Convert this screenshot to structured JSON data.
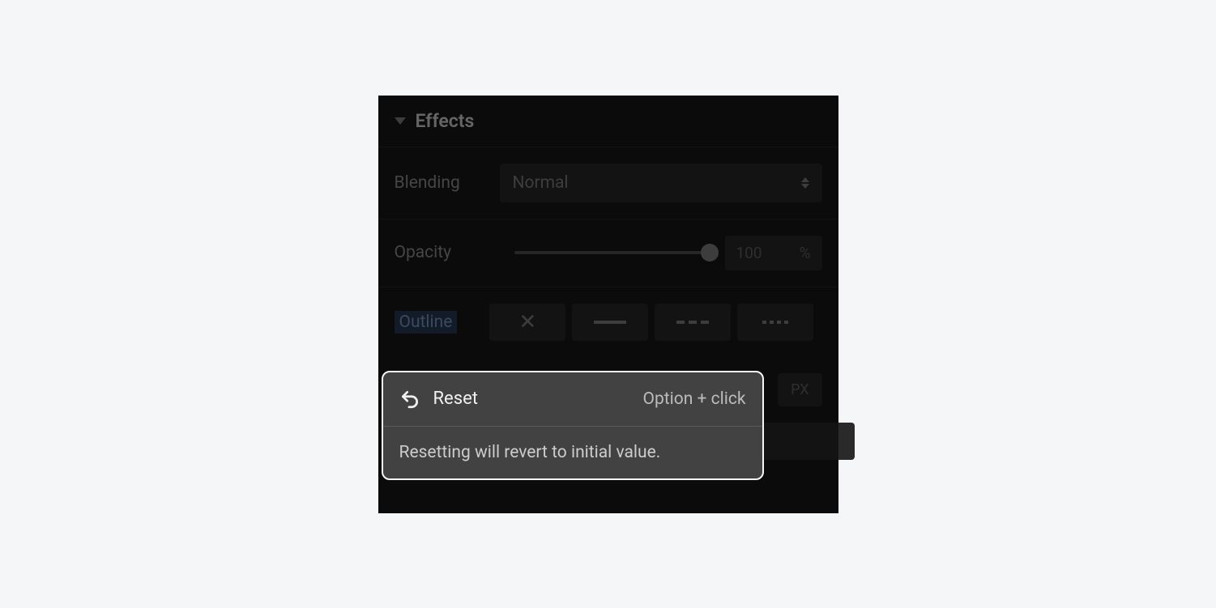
{
  "section": {
    "title": "Effects"
  },
  "blending": {
    "label": "Blending",
    "value": "Normal"
  },
  "opacity": {
    "label": "Opacity",
    "value": "100",
    "unit": "%"
  },
  "outline": {
    "label": "Outline",
    "px_unit": "PX"
  },
  "tooltip": {
    "action": "Reset",
    "shortcut": "Option + click",
    "description": "Resetting will revert to initial value."
  }
}
